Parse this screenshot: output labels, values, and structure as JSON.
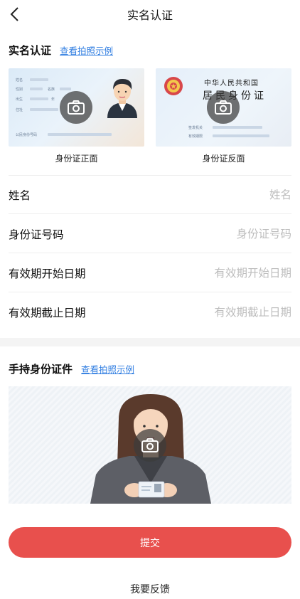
{
  "nav": {
    "title": "实名认证",
    "back_icon": "chevron-left-icon"
  },
  "id_section": {
    "title": "实名认证",
    "example_link": "查看拍照示例"
  },
  "id_cards": {
    "front_label": "身份证正面",
    "back_label": "身份证反面",
    "front_fields": [
      "姓名",
      "性别",
      "名族",
      "出生",
      "年",
      "住址",
      "公民身份号码"
    ],
    "back_header": "中华人民共和国",
    "back_title": "居民身份证",
    "back_fields": [
      "签发机关",
      "有效期限"
    ]
  },
  "form": {
    "name": {
      "label": "姓名",
      "placeholder": "姓名",
      "value": ""
    },
    "id_number": {
      "label": "身份证号码",
      "placeholder": "身份证号码",
      "value": ""
    },
    "valid_start": {
      "label": "有效期开始日期",
      "placeholder": "有效期开始日期",
      "value": ""
    },
    "valid_end": {
      "label": "有效期截止日期",
      "placeholder": "有效期截止日期",
      "value": ""
    }
  },
  "hold_section": {
    "title": "手持身份证件",
    "example_link": "查看拍照示例"
  },
  "actions": {
    "submit": "提交",
    "feedback": "我要反馈"
  },
  "colors": {
    "accent": "#e8504d",
    "link": "#2f7de1"
  }
}
